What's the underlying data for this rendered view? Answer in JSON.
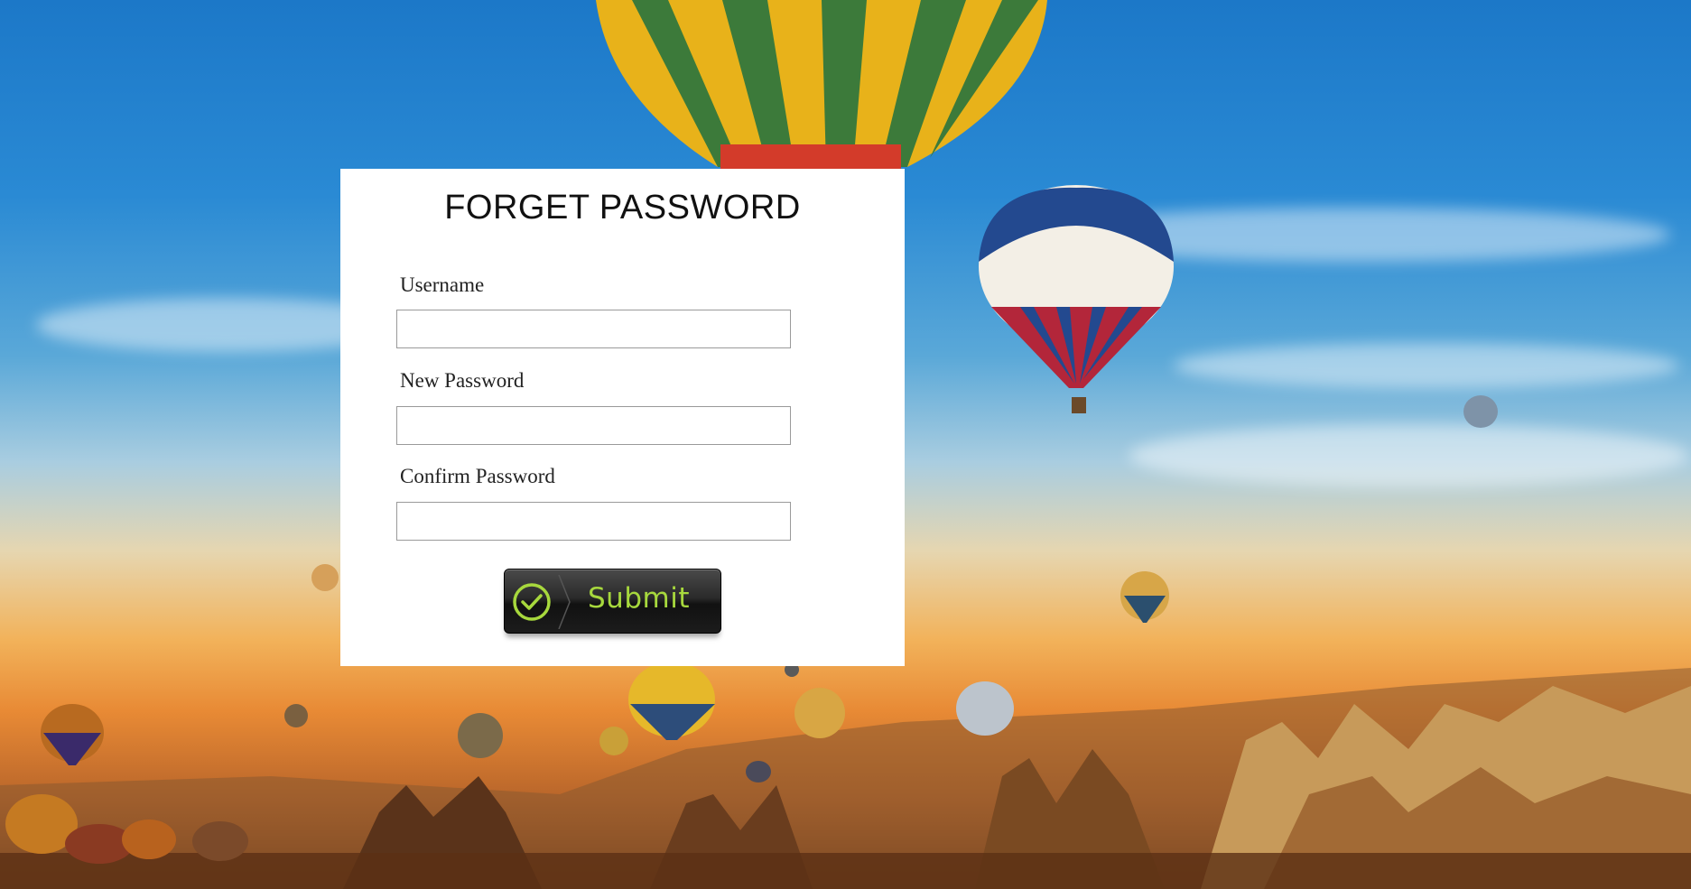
{
  "form": {
    "title": "FORGET PASSWORD",
    "username_label": "Username",
    "username_value": "",
    "new_password_label": "New Password",
    "new_password_value": "",
    "confirm_password_label": "Confirm Password",
    "confirm_password_value": "",
    "submit_label": "Submit",
    "submit_icon": "check-circle-icon"
  },
  "background": {
    "subject": "hot-air-balloons-over-valley",
    "sky_color": "#1c78c8",
    "sunset_color": "#f2b25a",
    "ground_color": "#6e3a1a"
  },
  "colors": {
    "submit_text": "#a7d83d",
    "panel_bg": "#ffffff"
  }
}
